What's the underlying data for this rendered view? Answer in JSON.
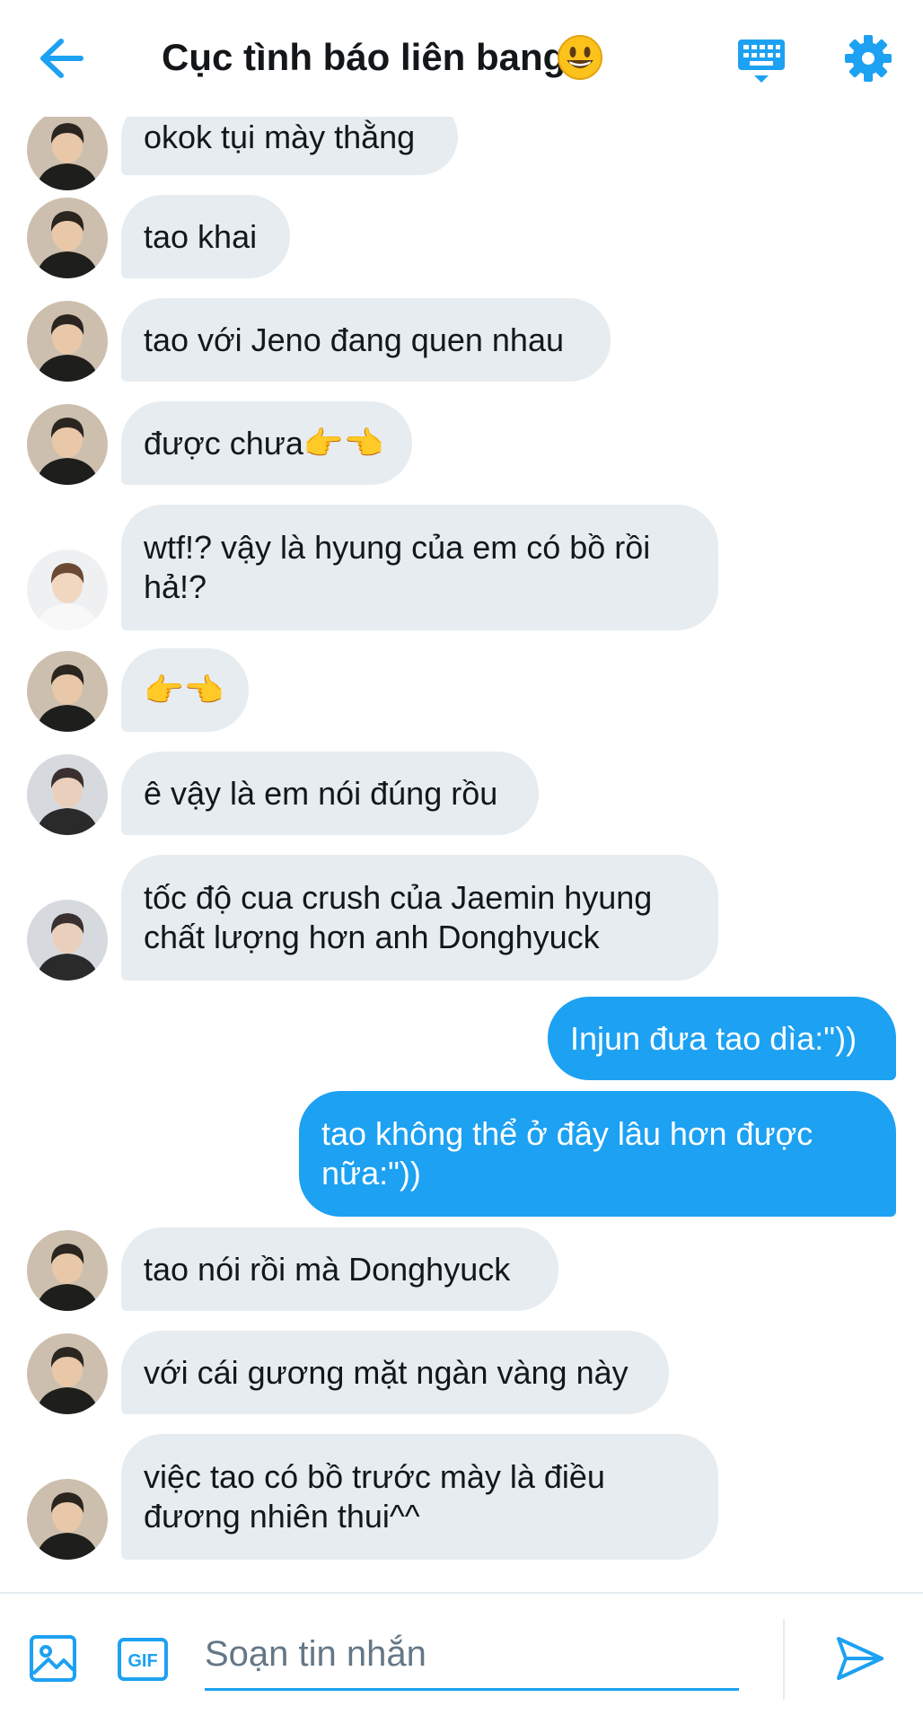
{
  "header": {
    "title": "Cục tình báo liên bang",
    "title_emoji": "grinning-face-emoji"
  },
  "messages": [
    {
      "dir": "in",
      "avatar": "avatar-a",
      "text": "okok tụi mày thằng",
      "emoji": ""
    },
    {
      "dir": "in",
      "avatar": "avatar-a",
      "text": "tao khai",
      "emoji": ""
    },
    {
      "dir": "in",
      "avatar": "avatar-a",
      "text": "tao với Jeno đang quen nhau",
      "emoji": ""
    },
    {
      "dir": "in",
      "avatar": "avatar-a",
      "text": "được chưa",
      "emoji": "👉👈"
    },
    {
      "dir": "in",
      "avatar": "avatar-b",
      "text": "wtf!? vậy là hyung của em có bồ rồi hả!?",
      "emoji": ""
    },
    {
      "dir": "in",
      "avatar": "avatar-a",
      "text": "",
      "emoji": "👉👈"
    },
    {
      "dir": "in",
      "avatar": "avatar-c",
      "text": "ê vậy là em nói đúng rồu",
      "emoji": ""
    },
    {
      "dir": "in",
      "avatar": "avatar-c",
      "text": "tốc độ cua crush của Jaemin hyung chất lượng hơn anh Donghyuck",
      "emoji": ""
    },
    {
      "dir": "out",
      "avatar": "",
      "text": "Injun đưa tao dìa:\"))",
      "emoji": ""
    },
    {
      "dir": "out",
      "avatar": "",
      "text": "tao không thể ở đây lâu hơn được nữa:\"))",
      "emoji": ""
    },
    {
      "dir": "in",
      "avatar": "avatar-a",
      "text": "tao nói rồi mà Donghyuck",
      "emoji": ""
    },
    {
      "dir": "in",
      "avatar": "avatar-a",
      "text": "với cái gương mặt ngàn vàng này",
      "emoji": ""
    },
    {
      "dir": "in",
      "avatar": "avatar-a",
      "text": "việc tao có bồ trước mày là điều đương nhiên thui^^",
      "emoji": ""
    }
  ],
  "composer": {
    "placeholder": "Soạn tin nhắn",
    "gif_label": "GIF"
  },
  "colors": {
    "accent": "#1da1f2",
    "incoming_bubble": "#e6ecf0",
    "text": "#14171a",
    "placeholder": "#657786"
  }
}
